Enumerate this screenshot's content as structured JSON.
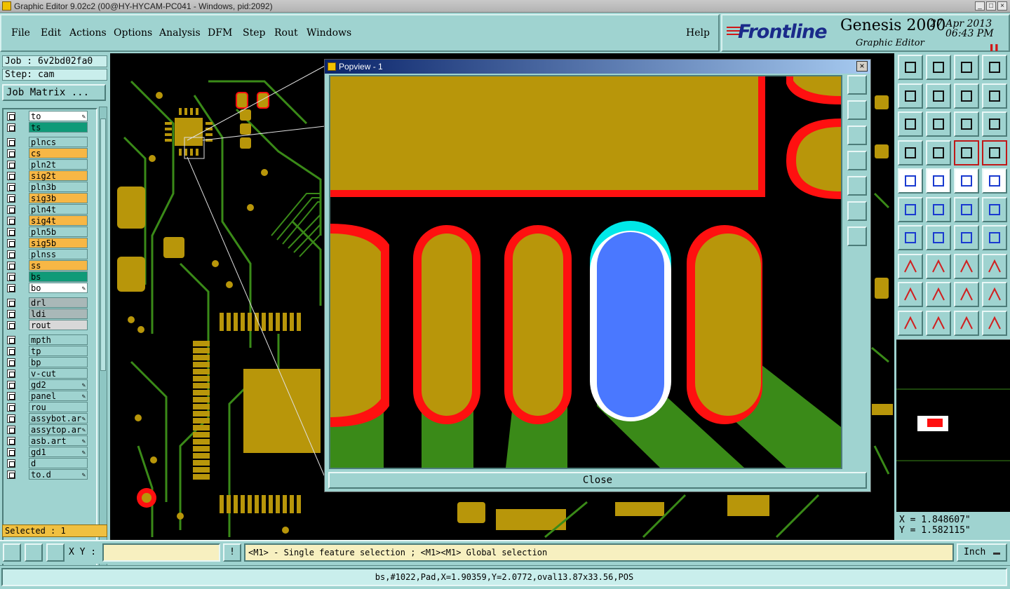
{
  "window": {
    "title": "Graphic Editor 9.02c2 (00@HY-HYCAM-PC041 - Windows, pid:2092)"
  },
  "menu": {
    "items": [
      "File",
      "Edit",
      "Actions",
      "Options",
      "Analysis",
      "DFM",
      "Step",
      "Rout",
      "Windows"
    ],
    "help": "Help"
  },
  "brand": {
    "logo": "Frontline",
    "product": "Genesis 2000",
    "subtitle": "Graphic Editor",
    "date": "27 Apr 2013",
    "time": "06:43 PM"
  },
  "job": {
    "job_label": "Job : 6v2bd02fa0",
    "step_label": "Step: cam",
    "matrix_button": "Job Matrix ..."
  },
  "layers": [
    {
      "name": "to",
      "color": "#ffffff",
      "editable": true
    },
    {
      "name": "ts",
      "color": "#0f9a78",
      "editable": false
    },
    {
      "name": "plncs",
      "color": "#9fd3d0",
      "editable": false
    },
    {
      "name": "cs",
      "color": "#f7b745",
      "editable": false
    },
    {
      "name": "pln2t",
      "color": "#9fd3d0",
      "editable": false
    },
    {
      "name": "sig2t",
      "color": "#f7b745",
      "editable": false
    },
    {
      "name": "pln3b",
      "color": "#9fd3d0",
      "editable": false
    },
    {
      "name": "sig3b",
      "color": "#f7b745",
      "editable": false
    },
    {
      "name": "pln4t",
      "color": "#9fd3d0",
      "editable": false
    },
    {
      "name": "sig4t",
      "color": "#f7b745",
      "editable": false
    },
    {
      "name": "pln5b",
      "color": "#9fd3d0",
      "editable": false
    },
    {
      "name": "sig5b",
      "color": "#f7b745",
      "editable": false
    },
    {
      "name": "plnss",
      "color": "#9fd3d0",
      "editable": false
    },
    {
      "name": "ss",
      "color": "#f7b745",
      "editable": false
    },
    {
      "name": "bs",
      "color": "#0f9a78",
      "editable": false
    },
    {
      "name": "bo",
      "color": "#ffffff",
      "editable": true
    },
    {
      "name": "drl",
      "color": "#a9b8b8",
      "editable": false
    },
    {
      "name": "ldi",
      "color": "#a9b8b8",
      "editable": false
    },
    {
      "name": "rout",
      "color": "#d8d8d8",
      "editable": false
    },
    {
      "name": "mpth",
      "color": "#9fd3d0",
      "editable": false
    },
    {
      "name": "tp",
      "color": "#9fd3d0",
      "editable": false
    },
    {
      "name": "bp",
      "color": "#9fd3d0",
      "editable": false
    },
    {
      "name": "v-cut",
      "color": "#9fd3d0",
      "editable": false
    },
    {
      "name": "gd2",
      "color": "#9fd3d0",
      "editable": true
    },
    {
      "name": "panel",
      "color": "#9fd3d0",
      "editable": true
    },
    {
      "name": "rou",
      "color": "#9fd3d0",
      "editable": false
    },
    {
      "name": "assybot.ar",
      "color": "#9fd3d0",
      "editable": true
    },
    {
      "name": "assytop.ar",
      "color": "#9fd3d0",
      "editable": true
    },
    {
      "name": "asb.art",
      "color": "#9fd3d0",
      "editable": true
    },
    {
      "name": "gd1",
      "color": "#9fd3d0",
      "editable": true
    },
    {
      "name": "d",
      "color": "#9fd3d0",
      "editable": false
    },
    {
      "name": "to.d",
      "color": "#9fd3d0",
      "editable": true
    }
  ],
  "selected": "Selected : 1",
  "popview": {
    "title": "Popview - 1",
    "close_label": "Close",
    "close_icon": "×"
  },
  "coords": {
    "x": "X = 1.848607\"",
    "y": "Y = 1.582115\""
  },
  "bottom": {
    "xy_label": "X Y :",
    "message": "<M1> - Single feature selection ; <M1><M1> Global selection",
    "unit": "Inch",
    "status": "bs,#1022,Pad,X=1.90359,Y=2.0772,oval13.87x33.56,POS"
  },
  "colors": {
    "copper": "#b8960a",
    "trace": "#3a8a18",
    "clearance": "#ff1010",
    "highlight": "#4a78ff",
    "select_outline": "#00e8e8"
  }
}
